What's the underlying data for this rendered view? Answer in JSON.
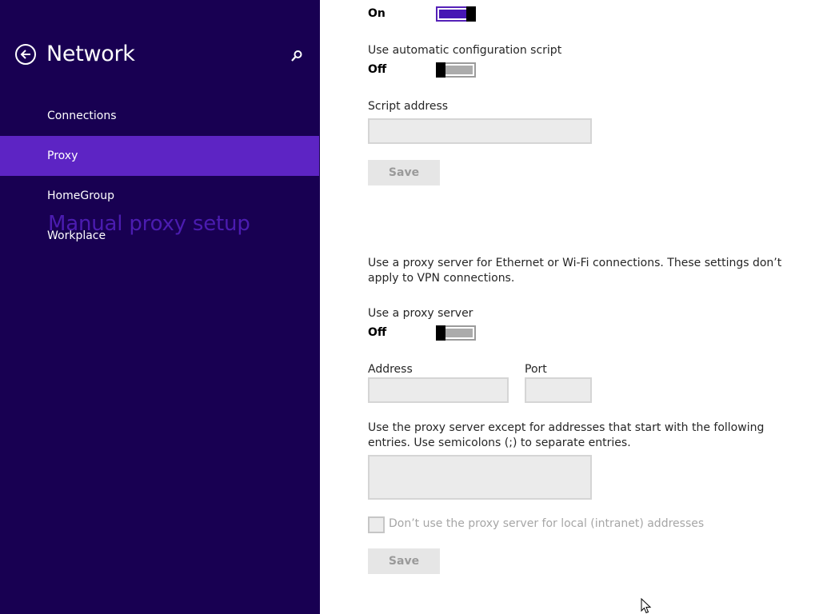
{
  "sidebar": {
    "title": "Network",
    "back_icon": "back-arrow-icon",
    "search_icon": "search-icon",
    "items": [
      {
        "label": "Connections",
        "active": false
      },
      {
        "label": "Proxy",
        "active": true
      },
      {
        "label": "HomeGroup",
        "active": false
      },
      {
        "label": "Workplace",
        "active": false
      }
    ]
  },
  "automatic": {
    "detect_state": "On",
    "script_toggle_label": "Use automatic configuration script",
    "script_state": "Off",
    "script_address_label": "Script address",
    "script_address_value": "",
    "save_label": "Save"
  },
  "manual": {
    "heading": "Manual proxy setup",
    "description": "Use a proxy server for Ethernet or Wi-Fi connections. These settings don’t apply to VPN connections.",
    "use_proxy_label": "Use a proxy server",
    "use_proxy_state": "Off",
    "address_label": "Address",
    "address_value": "",
    "port_label": "Port",
    "port_value": "",
    "exceptions_label": "Use the proxy server except for addresses that start with the following entries. Use semicolons (;) to separate entries.",
    "exceptions_value": "",
    "local_bypass_label": "Don’t use the proxy server for local (intranet) addresses",
    "local_bypass_checked": false,
    "save_label": "Save"
  },
  "colors": {
    "sidebar_bg": "#180052",
    "sidebar_active": "#5d24c4",
    "accent": "#4b1cb0",
    "toggle_on": "#4617b4"
  }
}
